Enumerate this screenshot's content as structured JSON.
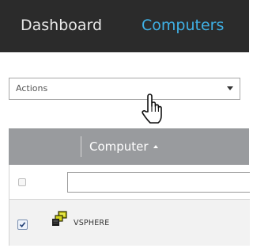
{
  "topnav": {
    "dashboard_label": "Dashboard",
    "computers_label": "Computers",
    "active_color": "#3fb1e6",
    "background": "#2b2b2b"
  },
  "actions": {
    "selected_label": "Actions",
    "caret_icon": "chevron-down-icon"
  },
  "grid": {
    "column_header": "Computer",
    "sort_icon": "sort-asc-icon",
    "filter_value": "",
    "rows": [
      {
        "checked": true,
        "icon": "computer-network-icon",
        "name": "VSPHERE"
      }
    ]
  },
  "cursor": {
    "icon": "hand-pointer-icon"
  }
}
